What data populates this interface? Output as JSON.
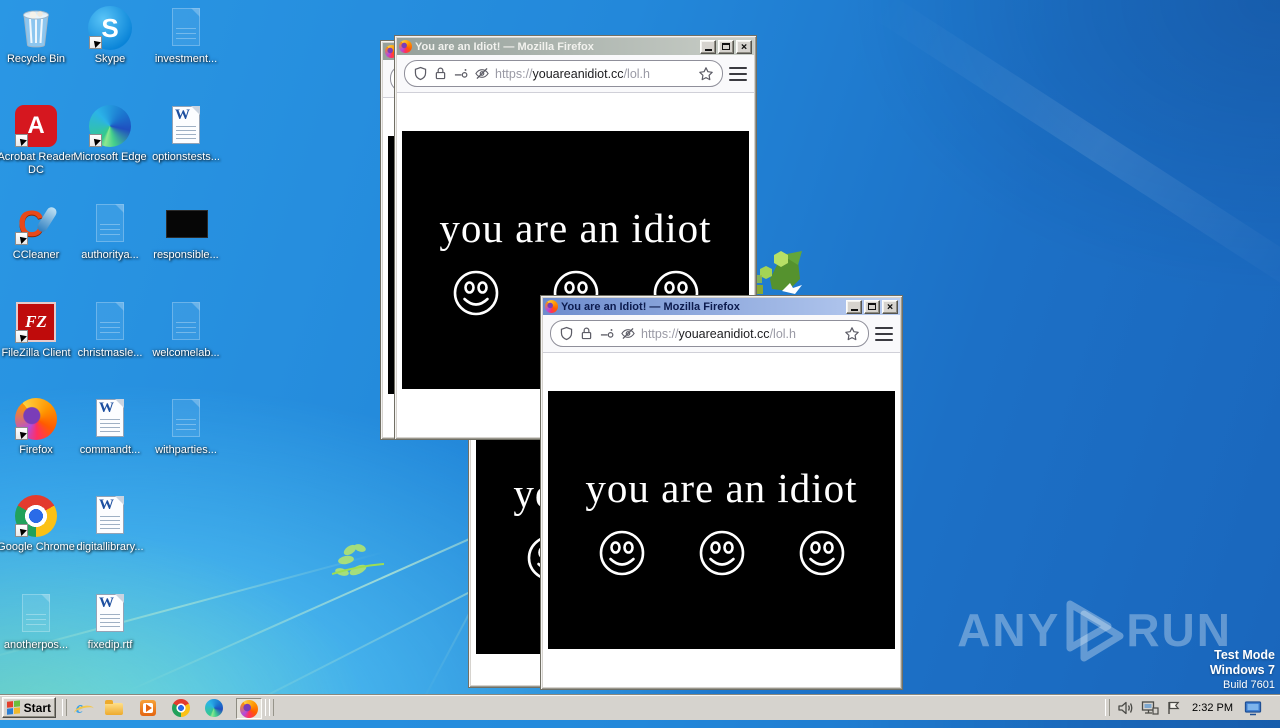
{
  "browser": {
    "title": "You are an Idiot! — Mozilla Firefox",
    "url_scheme": "https://",
    "url_host": "youareanidiot.cc",
    "url_path": "/lol.h",
    "page_text": "you are an idiot",
    "icons": [
      "shield-icon",
      "lock-icon",
      "permissions-icon",
      "tracking-blocked-eye-icon",
      "bookmark-star-icon",
      "menu-hamburger-icon"
    ],
    "page_bg": "#000000",
    "page_fg": "#ffffff"
  },
  "desktop": {
    "icons": [
      {
        "label": "Recycle Bin",
        "kind": "recycle-bin"
      },
      {
        "label": "Skype",
        "kind": "skype-shortcut"
      },
      {
        "label": "investment...",
        "kind": "file-faint"
      },
      {
        "label": "Acrobat Reader DC",
        "kind": "acrobat-shortcut"
      },
      {
        "label": "Microsoft Edge",
        "kind": "edge-shortcut"
      },
      {
        "label": "optionstests...",
        "kind": "word-document"
      },
      {
        "label": "CCleaner",
        "kind": "ccleaner-shortcut"
      },
      {
        "label": "authoritya...",
        "kind": "file-faint"
      },
      {
        "label": "responsible...",
        "kind": "file-black-thumbnail"
      },
      {
        "label": "FileZilla Client",
        "kind": "filezilla-shortcut"
      },
      {
        "label": "christmasle...",
        "kind": "file-faint"
      },
      {
        "label": "welcomelab...",
        "kind": "file-faint"
      },
      {
        "label": "Firefox",
        "kind": "firefox-shortcut"
      },
      {
        "label": "commandt...",
        "kind": "word-document"
      },
      {
        "label": "withparties...",
        "kind": "file-faint"
      },
      {
        "label": "Google Chrome",
        "kind": "chrome-shortcut"
      },
      {
        "label": "digitallibrary...",
        "kind": "word-document"
      },
      {
        "label": "anotherpos...",
        "kind": "file-faint"
      },
      {
        "label": "fixedip.rtf",
        "kind": "word-document"
      }
    ]
  },
  "taskbar": {
    "start_label": "Start",
    "quick_launch": [
      "Internet Explorer",
      "Windows Explorer",
      "Windows Media Player",
      "Google Chrome",
      "Microsoft Edge",
      "Mozilla Firefox"
    ],
    "tray_icons": [
      "volume-icon",
      "network-icon",
      "action-center-flag-icon",
      "show-desktop-monitor-icon"
    ],
    "clock": "2:32 PM",
    "taskbar_color": "#d6d3ce"
  },
  "watermark": {
    "brand_left": "ANY",
    "brand_right": "RUN",
    "mode": "Test Mode",
    "os": "Windows 7",
    "build": "Build 7601"
  },
  "colors": {
    "active_title_gradient": [
      "#6d8ccd",
      "#b9cdf1"
    ],
    "inactive_title_gradient": [
      "#95a09b",
      "#c9cec7"
    ],
    "desktop_blue": "#2388da",
    "desktop_cyan": "#69deff"
  }
}
